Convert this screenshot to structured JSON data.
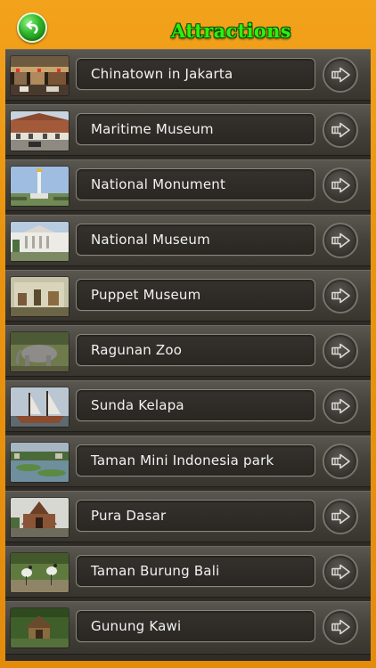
{
  "header": {
    "title": "Attractions",
    "back_icon": "back-arrow-icon"
  },
  "attractions": [
    {
      "label": "Chinatown in Jakarta",
      "thumb": "photo-chinatown"
    },
    {
      "label": "Maritime Museum",
      "thumb": "photo-maritime-museum"
    },
    {
      "label": "National Monument",
      "thumb": "photo-national-monument"
    },
    {
      "label": "National Museum",
      "thumb": "photo-national-museum"
    },
    {
      "label": "Puppet Museum",
      "thumb": "photo-puppet-museum"
    },
    {
      "label": "Ragunan Zoo",
      "thumb": "photo-ragunan-zoo"
    },
    {
      "label": "Sunda Kelapa",
      "thumb": "photo-sunda-kelapa"
    },
    {
      "label": "Taman Mini Indonesia park",
      "thumb": "photo-taman-mini"
    },
    {
      "label": "Pura Dasar",
      "thumb": "photo-pura-dasar"
    },
    {
      "label": "Taman Burung Bali",
      "thumb": "photo-taman-burung"
    },
    {
      "label": "Gunung Kawi",
      "thumb": "photo-gunung-kawi"
    }
  ],
  "row_action_icon": "forward-arrow-icon",
  "colors": {
    "background": "#e9940f",
    "title": "#2cf10c",
    "back_button": "#2fb52a",
    "row": "#45423c",
    "label_text": "#f2f2f2"
  }
}
